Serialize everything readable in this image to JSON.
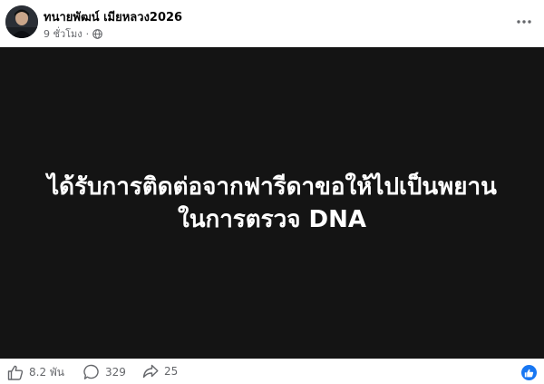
{
  "post": {
    "author": "ทนายพัฒน์ เมียหลวง2026",
    "time": "9 ชั่วโมง",
    "separator": "·",
    "privacy_icon": "globe-icon",
    "more_icon": "more-options-icon",
    "media_text": {
      "line1": "ได้รับการติดต่อจากฟารีดาขอให้ไปเป็นพยาน",
      "line2": "ในการตรวจ DNA"
    },
    "stats": {
      "likes": "8.2 พัน",
      "comments": "329",
      "shares": "25"
    },
    "colors": {
      "media_background": "#141414",
      "accent": "#1877f2",
      "secondary_text": "#65676b"
    }
  }
}
